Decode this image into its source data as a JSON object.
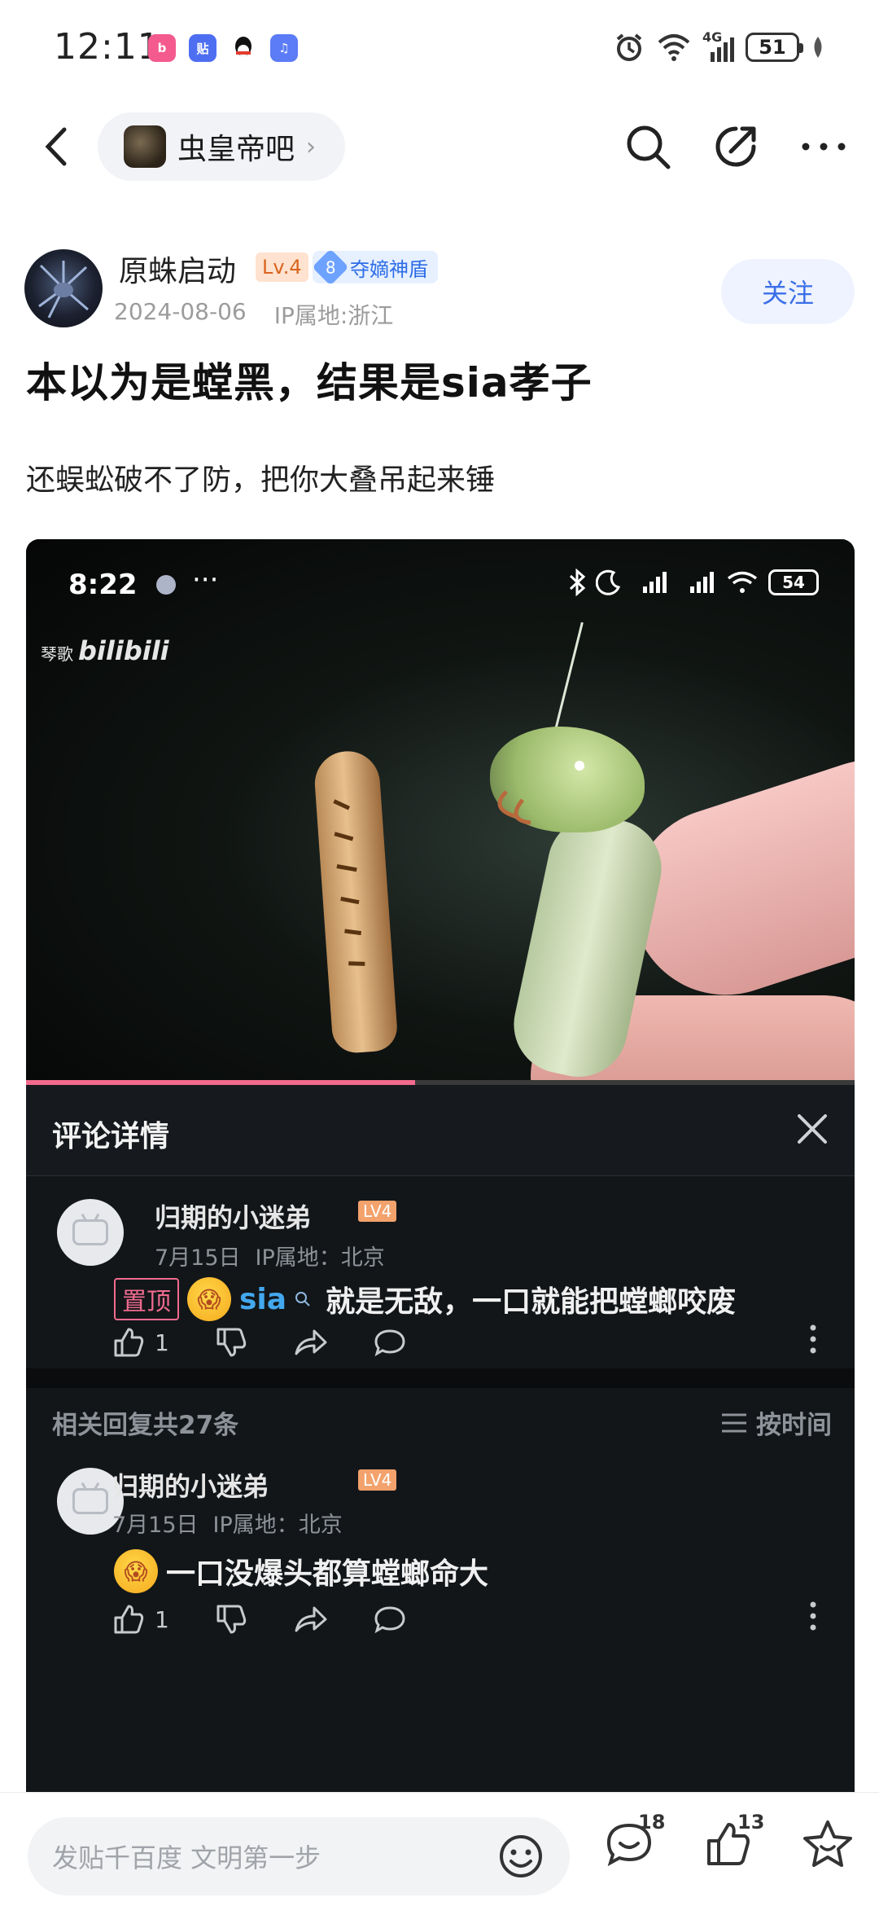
{
  "status_bar": {
    "time": "12:11",
    "app_icons": [
      "bilibili",
      "tieba",
      "qq",
      "music"
    ],
    "network": "4G",
    "battery": "51"
  },
  "nav": {
    "forum_name": "虫皇帝吧",
    "chevron": "›"
  },
  "author": {
    "name": "原蛛启动",
    "level": "Lv.4",
    "medal_level": "8",
    "medal_name": "夺嫡神盾",
    "date": "2024-08-06",
    "ip": "IP属地:浙江",
    "follow_label": "关注"
  },
  "post": {
    "title": "本以为是螳黑，结果是sia孝子",
    "body": "还蜈蚣破不了防，把你大叠吊起来锤"
  },
  "embedded": {
    "status_time": "8:22",
    "status_more": "···",
    "battery": "54",
    "watermark_small": "琴歌",
    "watermark_brand": "bilibili",
    "video_progress": 0.47,
    "comment_header": "评论详情",
    "comments": [
      {
        "name": "归期的小迷弟",
        "level": "LV4",
        "date": "7月15日",
        "ip": "IP属地：北京",
        "pin": "置顶",
        "mention": "sia",
        "text": "就是无敌，一口就能把螳螂咬废",
        "likes": "1"
      },
      {
        "name": "归期的小迷弟",
        "level": "LV4",
        "date": "7月15日",
        "ip": "IP属地：北京",
        "text": "一口没爆头都算螳螂命大",
        "likes": "1"
      }
    ],
    "replies_count": "相关回复共27条",
    "sort_label": "按时间"
  },
  "bottom": {
    "placeholder": "发贴千百度 文明第一步",
    "comment_count": "18",
    "like_count": "13"
  },
  "colors": {
    "accent_blue": "#3b6fe8",
    "bili_pink": "#f26a8c",
    "level_orange": "#d9651f"
  }
}
